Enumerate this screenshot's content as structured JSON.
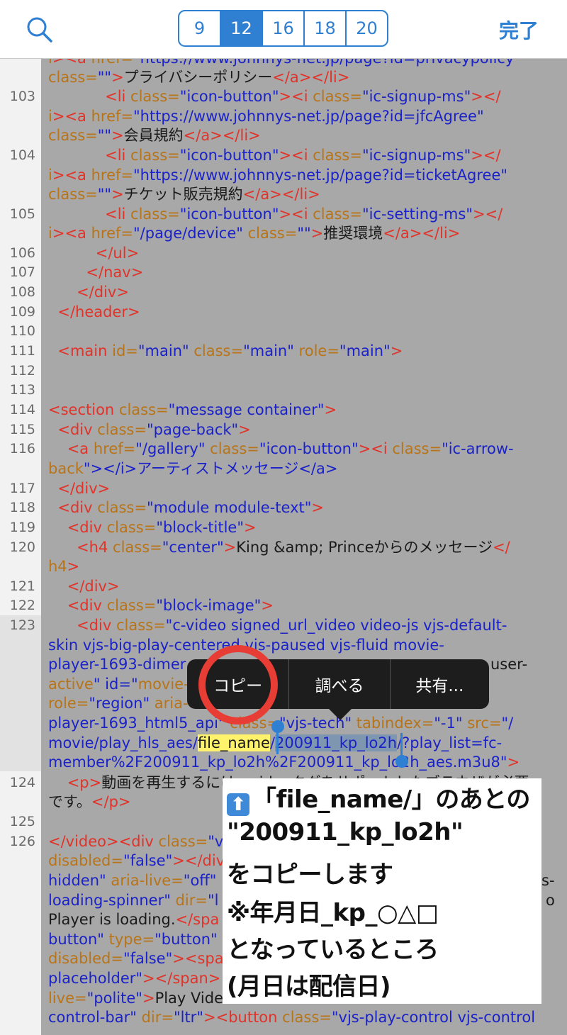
{
  "toolbar": {
    "search_icon": "magnifier",
    "font_sizes": [
      "9",
      "12",
      "16",
      "18",
      "20"
    ],
    "selected_size": "12",
    "done_label": "完了"
  },
  "context_menu": {
    "items": [
      "コピー",
      "調べる",
      "共有..."
    ]
  },
  "colors": {
    "accent": "#2f7fd3",
    "tag": "#e0332a",
    "attribute": "#b87418",
    "value": "#1a22c8",
    "highlight": "#fff36b",
    "circle": "#e73d35"
  },
  "annotation": {
    "icon": "up-arrow-icon",
    "lines": [
      "「file_name/」のあとの",
      "\"200911_kp_lo2h\"",
      "をコピーします",
      "※年月日_kp_○△□",
      "となっているところ",
      "(月日は配信日)"
    ]
  },
  "code": {
    "line_numbers": [
      "103",
      "104",
      "105",
      "106",
      "107",
      "108",
      "109",
      "110",
      "111",
      "112",
      "113",
      "114",
      "115",
      "116",
      "117",
      "118",
      "119",
      "120",
      "121",
      "122",
      "123",
      "124",
      "125",
      "126"
    ],
    "lines": [
      "i><a href=\"https://www.johnnys-net.jp/page?id=privacypolicy\"",
      "class=\"\">プライバシーポリシー</a></li>",
      "            <li class=\"icon-button\"><i class=\"ic-signup-ms\"></",
      "i><a href=\"https://www.johnnys-net.jp/page?id=jfcAgree\"",
      "class=\"\">会員規約</a></li>",
      "            <li class=\"icon-button\"><i class=\"ic-signup-ms\"></",
      "i><a href=\"https://www.johnnys-net.jp/page?id=ticketAgree\"",
      "class=\"\">チケット販売規約</a></li>",
      "            <li class=\"icon-button\"><i class=\"ic-setting-ms\"></",
      "i><a href=\"/page/device\" class=\"\">推奨環境</a></li>",
      "          </ul>",
      "        </nav>",
      "      </div>",
      "  </header>",
      "  <main id=\"main\" class=\"main\" role=\"main\">",
      "<section class=\"message container\">",
      "  <div class=\"page-back\">",
      "    <a href=\"/gallery\" class=\"icon-button\"><i class=\"ic-arrow-",
      "back\"></i>アーティストメッセージ</a>",
      "  </div>",
      "  <div class=\"module module-text\">",
      "    <div class=\"block-title\">",
      "      <h4 class=\"center\">King &amp; Princeからのメッセージ</",
      "h4>",
      "    </div>",
      "    <div class=\"block-image\">",
      "      <div class=\"c-video signed_url_video video-js vjs-default-",
      "skin vjs-big-play-centered vjs-paused vjs-fluid movie-",
      "player-1693-dimer",
      "active\" id=\"movie-",
      "role=\"region\" aria-",
      "player-1693_html5_api\" class=\"vjs-tech\" tabindex=\"-1\" src=\"/",
      "movie/play_hls_aes/",
      "file_name",
      "/",
      "200911_kp_lo2h",
      "/?play_list=fc-",
      "member%2F200911_kp_lo2h%2F200911_kp_lo2h_aes.m3u8\">",
      "    <p>動画を再生するには、videoタグをサポートしたブラウザが必要",
      "です。</p>",
      "</video><div class=\"v",
      "disabled=\"false\"></div",
      "hidden\" aria-live=\"off\"",
      "loading-spinner\" dir=\"l",
      "Player is loading.</spa",
      "button\" type=\"button\"",
      "disabled=\"false\"><spa",
      "placeholder\"></span>",
      "live=\"polite\">Play Vide",
      "control-bar\" dir=\"ltr\"><button class=\"vjs-play-control vjs-control",
      "user-",
      "s-",
      "o"
    ]
  }
}
